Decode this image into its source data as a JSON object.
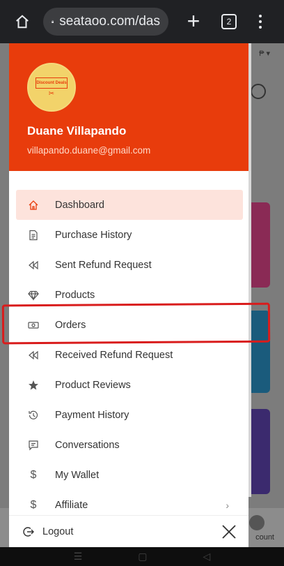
{
  "browser": {
    "url": "seataoo.com/das",
    "tab_count": "2"
  },
  "background": {
    "account_label": "count"
  },
  "drawer": {
    "avatar_text": "Discount Deals",
    "user_name": "Duane Villapando",
    "user_email": "villapando.duane@gmail.com",
    "menu": [
      {
        "label": "Dashboard",
        "icon": "home-icon",
        "active": true
      },
      {
        "label": "Purchase History",
        "icon": "document-icon"
      },
      {
        "label": "Sent Refund Request",
        "icon": "rewind-icon"
      },
      {
        "label": "Products",
        "icon": "diamond-icon"
      },
      {
        "label": "Orders",
        "icon": "money-icon"
      },
      {
        "label": "Received Refund Request",
        "icon": "rewind-icon"
      },
      {
        "label": "Product Reviews",
        "icon": "star-icon"
      },
      {
        "label": "Payment History",
        "icon": "history-icon"
      },
      {
        "label": "Conversations",
        "icon": "chat-icon"
      },
      {
        "label": "My Wallet",
        "icon": "dollar-icon"
      },
      {
        "label": "Affiliate",
        "icon": "dollar-icon",
        "has_chevron": true
      }
    ],
    "logout_label": "Logout"
  },
  "colors": {
    "header": "#e83c0c",
    "active_bg": "#fde3dc",
    "annotation": "#d91c1c"
  }
}
